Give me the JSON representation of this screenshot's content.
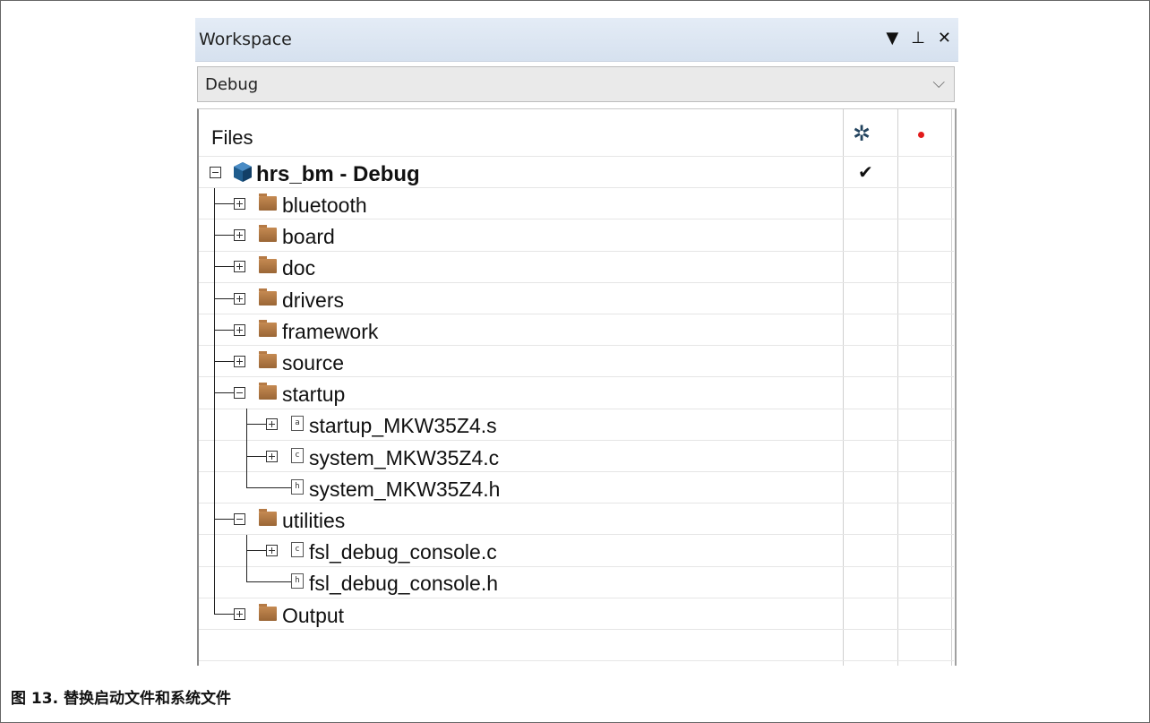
{
  "workspace": {
    "title": "Workspace",
    "controls": {
      "menu": "▼",
      "pin": "ᵖ",
      "close": "✕"
    },
    "config_dropdown": {
      "selected": "Debug"
    }
  },
  "files_panel": {
    "header": "Files",
    "icons": {
      "settings": "gear-icon",
      "build_status": "red-dot-icon"
    },
    "root": {
      "label": "hrs_bm - Debug",
      "checked_mark": "✔"
    },
    "tree": [
      {
        "label": "bluetooth",
        "type": "folder",
        "state": "collapsed"
      },
      {
        "label": "board",
        "type": "folder",
        "state": "collapsed"
      },
      {
        "label": "doc",
        "type": "folder",
        "state": "collapsed"
      },
      {
        "label": "drivers",
        "type": "folder",
        "state": "collapsed"
      },
      {
        "label": "framework",
        "type": "folder",
        "state": "collapsed"
      },
      {
        "label": "source",
        "type": "folder",
        "state": "collapsed"
      },
      {
        "label": "startup",
        "type": "folder",
        "state": "expanded"
      },
      {
        "label": "startup_MKW35Z4.s",
        "type": "file",
        "ext_glyph": "a",
        "state": "collapsed"
      },
      {
        "label": "system_MKW35Z4.c",
        "type": "file",
        "ext_glyph": "c",
        "state": "collapsed"
      },
      {
        "label": "system_MKW35Z4.h",
        "type": "file",
        "ext_glyph": "h",
        "state": "leaf"
      },
      {
        "label": "utilities",
        "type": "folder",
        "state": "expanded"
      },
      {
        "label": "fsl_debug_console.c",
        "type": "file",
        "ext_glyph": "c",
        "state": "collapsed"
      },
      {
        "label": "fsl_debug_console.h",
        "type": "file",
        "ext_glyph": "h",
        "state": "leaf"
      },
      {
        "label": "Output",
        "type": "folder",
        "state": "collapsed"
      }
    ]
  },
  "caption": "图 13. 替换启动文件和系统文件",
  "colors": {
    "folder": "#b07642",
    "titlebar": "#dbe5f1",
    "accent_dot": "#e21b1b",
    "gear": "#22435e"
  }
}
